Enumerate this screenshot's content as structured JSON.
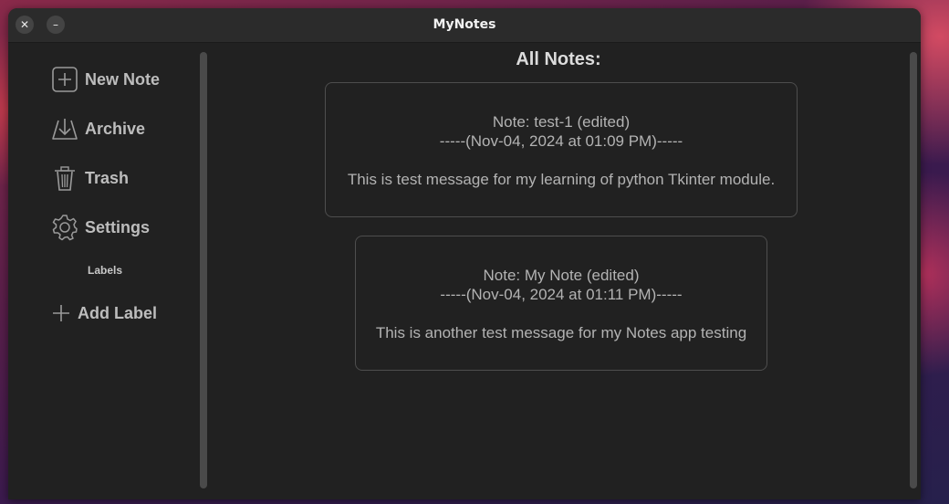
{
  "window": {
    "title": "MyNotes",
    "close_symbol": "✕",
    "minimize_symbol": "–"
  },
  "sidebar": {
    "items": [
      {
        "label": "New Note",
        "icon": "plus-square-icon"
      },
      {
        "label": "Archive",
        "icon": "archive-download-icon"
      },
      {
        "label": "Trash",
        "icon": "trash-icon"
      },
      {
        "label": "Settings",
        "icon": "gear-icon"
      }
    ],
    "labels_heading": "Labels",
    "add_label": {
      "label": "Add Label",
      "icon": "plus-icon"
    }
  },
  "main": {
    "title": "All Notes:",
    "notes": [
      {
        "title": "Note: test-1 (edited)",
        "date": "-----(Nov-04, 2024 at 01:09 PM)-----",
        "body": "This is test message for my learning of python Tkinter module."
      },
      {
        "title": "Note: My Note (edited)",
        "date": "-----(Nov-04, 2024 at 01:11 PM)-----",
        "body": "This is another test message for my Notes app testing"
      }
    ]
  },
  "colors": {
    "window_bg": "#212121",
    "titlebar_bg": "#2b2b2b",
    "text_muted": "#b3b3b3",
    "card_border": "#4e4e4e"
  }
}
